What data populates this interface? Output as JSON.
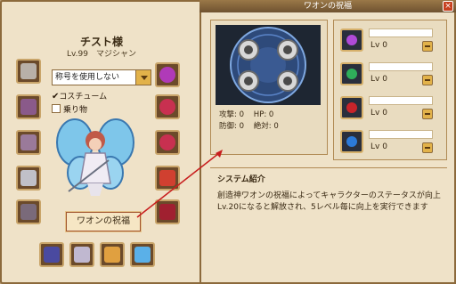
{
  "character": {
    "name": "チスト様",
    "level_class": "Lv.99　マジシャン",
    "title_select": "称号を使用しない",
    "costume_label": "コスチューム",
    "costume_checked": true,
    "mount_label": "乗り物",
    "mount_checked": false
  },
  "blessing_button": "ワオンの祝福",
  "window": {
    "title": "ワオンの祝福",
    "close_symbol": "×"
  },
  "stats": {
    "attack_label": "攻撃: 0",
    "hp_label": "HP: 0",
    "defense_label": "防御: 0",
    "absolute_label": "絶対: 0"
  },
  "blessings": [
    {
      "level": "Lv 0",
      "color": "#b04ad8"
    },
    {
      "level": "Lv 0",
      "color": "#2fae5a"
    },
    {
      "level": "Lv 0",
      "color": "#c8242a"
    },
    {
      "level": "Lv 0",
      "color": "#2c7ad8"
    }
  ],
  "system": {
    "heading": "システム紹介",
    "line1": "創造神ワオンの祝福によってキャラクターのステータスが向上",
    "line2": "Lv.20になると解放され、5レベル毎に向上を実行できます"
  }
}
